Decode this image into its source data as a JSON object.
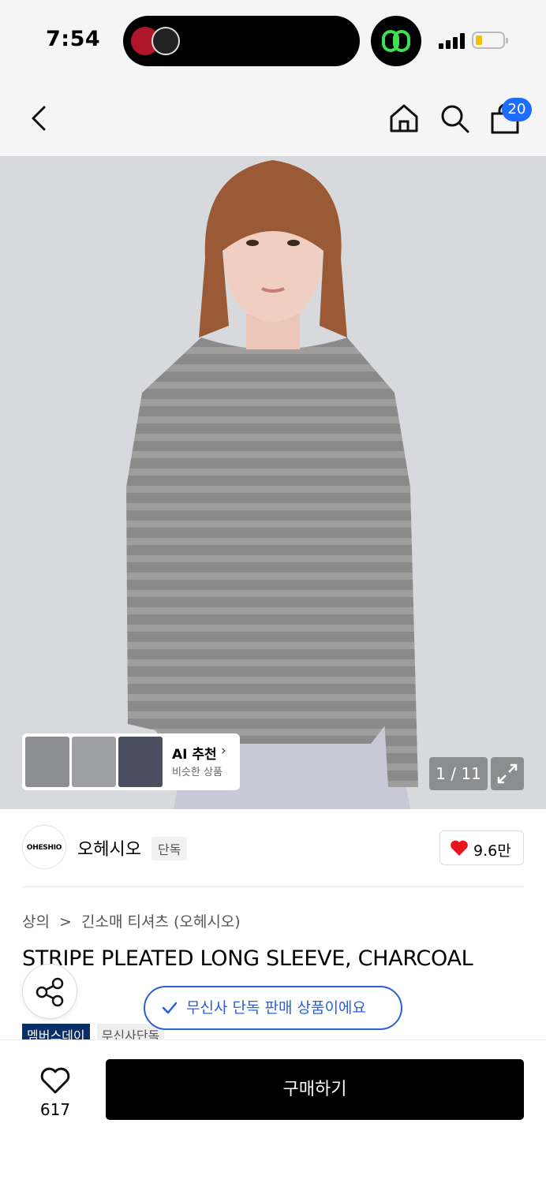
{
  "status_bar": {
    "time": "7:54"
  },
  "nav": {
    "cart_count": "20"
  },
  "hero": {
    "ai_reco_title": "AI 추천",
    "ai_reco_sub": "비슷한 상품",
    "counter": "1 / 11"
  },
  "brand": {
    "logo_text": "OHESHIO",
    "name": "오헤시오",
    "tag": "단독",
    "likes": "9.6만"
  },
  "breadcrumb": {
    "category": "상의",
    "sep": ">",
    "subcategory": "긴소매 티셔츠 (오헤시오)"
  },
  "product": {
    "title": "STRIPE PLEATED LONG SLEEVE, CHARCOAL"
  },
  "tags": {
    "member_day": "멤버스데이",
    "exclusive": "무신사단독"
  },
  "notice": {
    "exclusive_pill": "무신사 단독 판매 상품이에요"
  },
  "bottom_bar": {
    "wish_count": "617",
    "buy_label": "구매하기"
  },
  "colors": {
    "accent_blue": "#2a5fd6",
    "badge_blue": "#1e6bff",
    "heart_red": "#e8141e",
    "member_navy": "#0a2f66"
  }
}
